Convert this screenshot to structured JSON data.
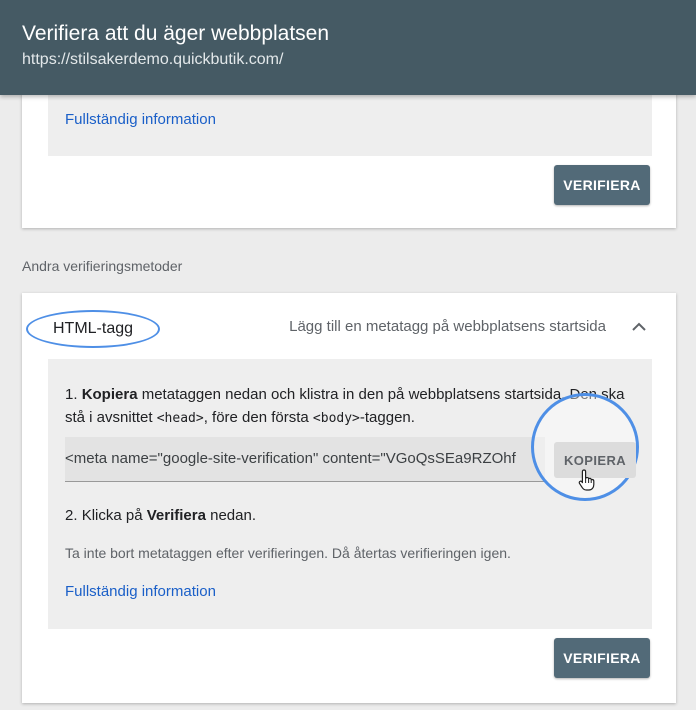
{
  "header": {
    "title": "Verifiera att du äger webbplatsen",
    "url": "https://stilsakerdemo.quickbutik.com/"
  },
  "top_card": {
    "link": "Fullständig information",
    "verify_button": "VERIFIERA"
  },
  "other_methods_label": "Andra verifieringsmetoder",
  "html_tag_method": {
    "title": "HTML-tagg",
    "description": "Lägg till en metatagg på webbplatsens startsida",
    "expanded_icon": "chevron-up-icon",
    "step1": {
      "number": "1.",
      "bold": "Kopiera",
      "text_a": "metataggen nedan och klistra in den på webbplatsens startsida. Den ska stå i avsnittet",
      "head_tag": "<head>",
      "text_b": ", före den första",
      "body_tag": "<body>",
      "text_c": "-taggen."
    },
    "meta_tag_value": "<meta name=\"google-site-verification\" content=\"VGoQsSEa9RZOhf",
    "copy_button": "KOPIERA",
    "step2": {
      "number": "2.",
      "text_a": "Klicka på",
      "bold": "Verifiera",
      "text_b": "nedan."
    },
    "note": "Ta inte bort metataggen efter verifieringen. Då återtas verifieringen igen.",
    "link": "Fullständig information",
    "verify_button": "VERIFIERA"
  },
  "colors": {
    "header_bg": "#455a64",
    "button_bg": "#526a78",
    "link": "#1a5fc8",
    "highlight_ring": "#4e8fe6"
  }
}
